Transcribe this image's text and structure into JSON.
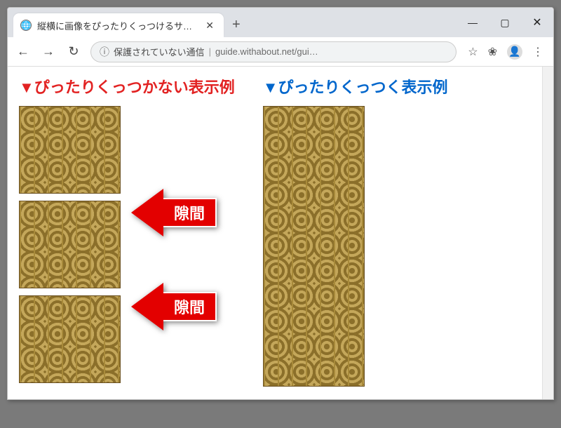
{
  "window": {
    "tab_title": "縦横に画像をぴったりくっつけるサンプ",
    "minimize_glyph": "—",
    "maximize_glyph": "▢",
    "close_glyph": "✕",
    "new_tab_glyph": "+",
    "tab_close_glyph": "✕"
  },
  "addressbar": {
    "back_glyph": "←",
    "forward_glyph": "→",
    "reload_glyph": "↻",
    "info_glyph": "ⓘ",
    "security_text": "保護されていない通信",
    "divider": "|",
    "url_display": "guide.withabout.net/gui…",
    "star_glyph": "☆",
    "ext_glyph": "❀",
    "avatar_glyph": "👤",
    "menu_glyph": "⋮"
  },
  "page": {
    "left_heading": "▼ぴったりくっつかない表示例",
    "right_heading": "▼ぴったりくっつく表示例",
    "gap_label": "隙間"
  }
}
